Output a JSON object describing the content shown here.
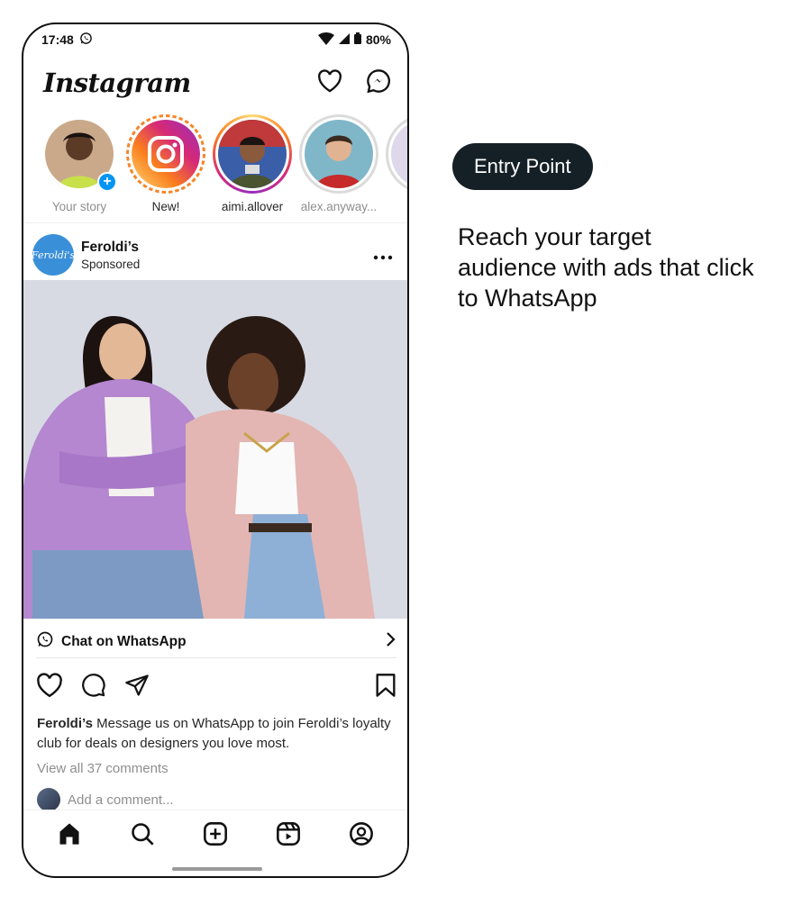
{
  "status_bar": {
    "time": "17:48",
    "battery": "80%"
  },
  "header": {
    "logo": "Instagram"
  },
  "stories": [
    {
      "label": "Your story",
      "muted": true
    },
    {
      "label": "New!",
      "muted": false
    },
    {
      "label": "aimi.allover",
      "muted": false
    },
    {
      "label": "alex.anyway...",
      "muted": true
    }
  ],
  "post": {
    "brand_avatar_text": "Feroldi's",
    "name": "Feroldi’s",
    "sponsored": "Sponsored",
    "cta": "Chat on WhatsApp",
    "caption_name": "Feroldi’s",
    "caption_text": " Message us on WhatsApp to join Feroldi’s loyalty club for deals on designers you love most.",
    "view_comments": "View all 37 comments",
    "add_comment": "Add a comment..."
  },
  "side": {
    "pill": "Entry Point",
    "description": "Reach your target audience with ads that click to WhatsApp"
  },
  "colors": {
    "pill_bg": "#152026",
    "story_blue": "#0095f6",
    "brand_blue": "#3a8fd9"
  }
}
